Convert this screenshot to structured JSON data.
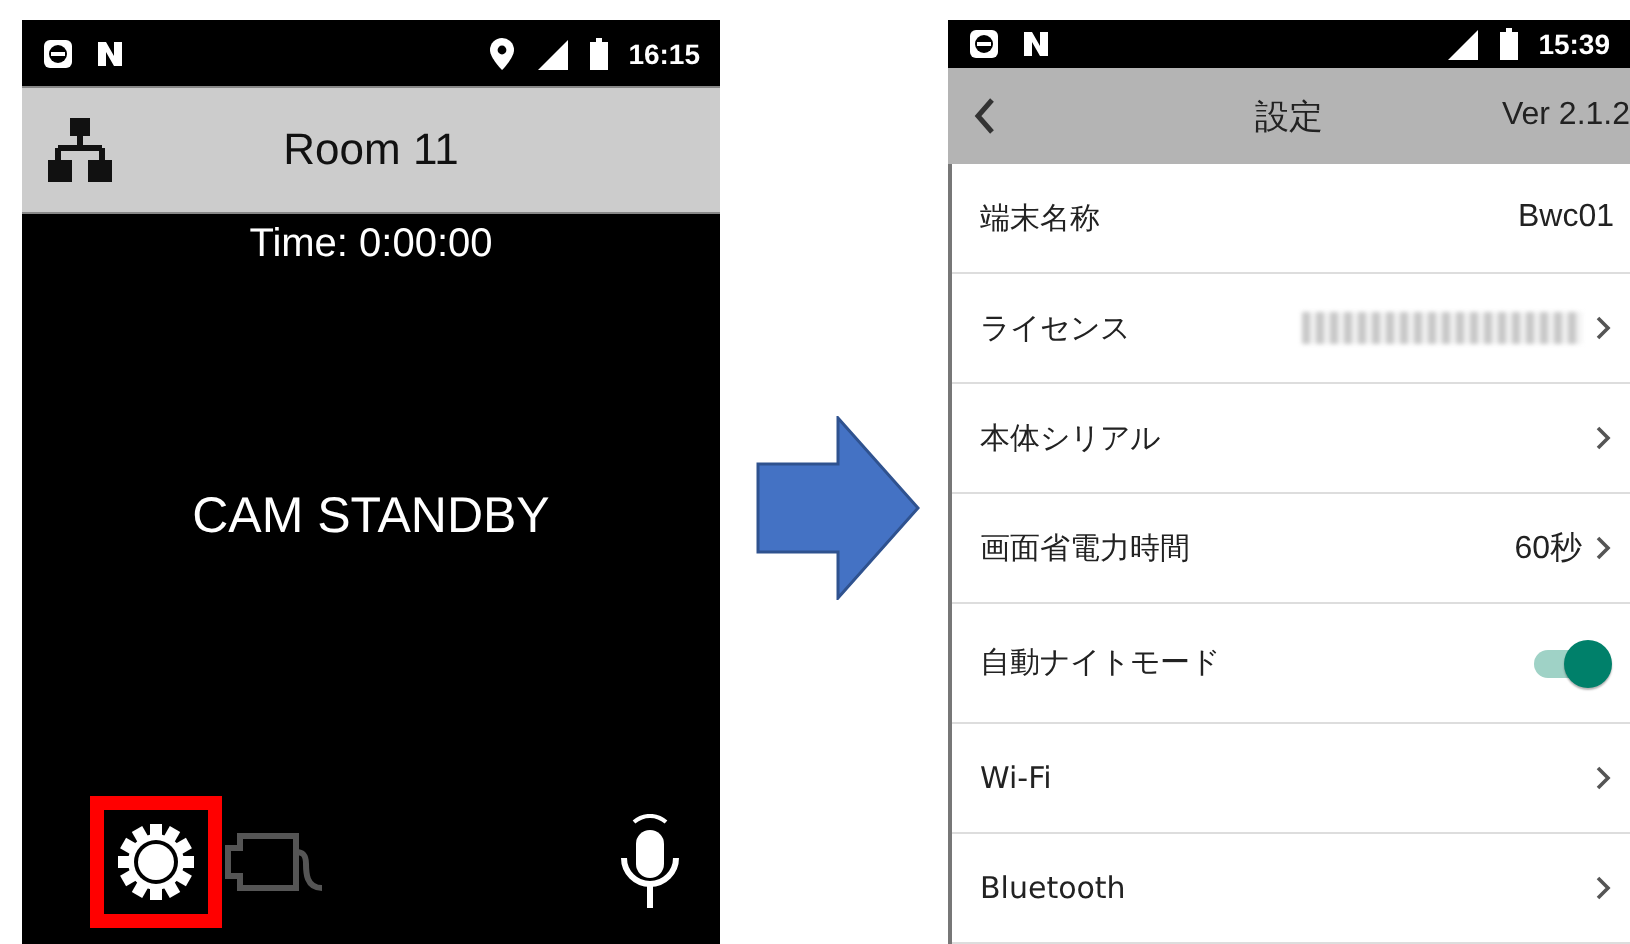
{
  "left_screen": {
    "status_bar": {
      "time": "16:15"
    },
    "header": {
      "title": "Room 11"
    },
    "timer": "Time: 0:00:00",
    "status": "CAM STANDBY",
    "toolbar": {
      "settings_highlighted": true,
      "camera_disabled": true
    }
  },
  "right_screen": {
    "status_bar": {
      "time": "15:39"
    },
    "header": {
      "title": "設定",
      "version": "Ver 2.1.2"
    },
    "rows": [
      {
        "kind": "value",
        "label": "端末名称",
        "value": "Bwc01",
        "chevron": false
      },
      {
        "kind": "redacted",
        "label": "ライセンス",
        "chevron": true
      },
      {
        "kind": "value",
        "label": "本体シリアル",
        "chevron": true
      },
      {
        "kind": "value",
        "label": "画面省電力時間",
        "value": "60秒",
        "chevron": true
      },
      {
        "kind": "toggle",
        "label": "自動ナイトモード",
        "on": true
      },
      {
        "kind": "value",
        "label": "Wi-Fi",
        "chevron": true
      },
      {
        "kind": "value",
        "label": "Bluetooth",
        "chevron": true
      }
    ]
  }
}
